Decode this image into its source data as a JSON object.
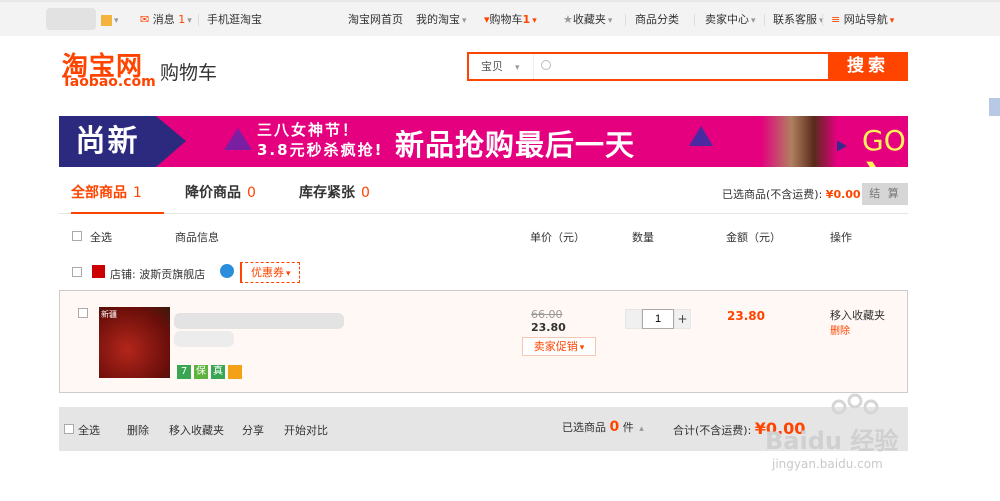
{
  "topbar": {
    "messages_label": "消息",
    "messages_count": "1",
    "mobile_label": "手机逛淘宝",
    "home_link": "淘宝网首页",
    "my_taobao": "我的淘宝",
    "cart_label": "购物车",
    "cart_count": "1",
    "favorites": "收藏夹",
    "categories": "商品分类",
    "seller_center": "卖家中心",
    "contact": "联系客服",
    "site_nav": "网站导航"
  },
  "header": {
    "logo": "淘宝网",
    "logo_sub": "Taobao.com",
    "title": "购物车"
  },
  "search": {
    "type": "宝贝",
    "value": "",
    "button": "搜索"
  },
  "banner": {
    "left_text": "尚新",
    "line1": "三八女神节！",
    "line2": "3.8元秒杀疯抢!",
    "headline": "新品抢购最后一天",
    "go": "GO"
  },
  "tabs": [
    {
      "label": "全部商品",
      "count": "1"
    },
    {
      "label": "降价商品",
      "count": "0"
    },
    {
      "label": "库存紧张",
      "count": "0"
    }
  ],
  "selected": {
    "label": "已选商品(不含运费):",
    "price": "¥0.00",
    "settle": "结 算"
  },
  "columns": {
    "select_all": "全选",
    "info": "商品信息",
    "unit_price": "单价（元）",
    "quantity": "数量",
    "amount": "金额（元）",
    "action": "操作"
  },
  "shop": {
    "label": "店铺:",
    "name": "波斯贡旗舰店",
    "coupon": "优惠券"
  },
  "item": {
    "thumb_label": "新疆",
    "old_price": "66.00",
    "price": "23.80",
    "promo": "卖家促销",
    "quantity": "1",
    "total": "23.80",
    "move_to_fav": "移入收藏夹",
    "delete": "删除",
    "badges": [
      "7",
      "保",
      "真",
      "卡"
    ]
  },
  "footer": {
    "select_all": "全选",
    "delete": "删除",
    "move_to_fav": "移入收藏夹",
    "share": "分享",
    "compare": "开始对比",
    "selected_label": "已选商品",
    "selected_count": "0",
    "unit": "件",
    "total_label": "合计(不含运费):",
    "total_value": "¥0.00"
  },
  "watermark": {
    "brand": "Baidu 经验",
    "url": "jingyan.baidu.com"
  },
  "colors": {
    "accent": "#ff4400",
    "banner_pink": "#e4007f",
    "banner_navy": "#2c2a7e"
  }
}
